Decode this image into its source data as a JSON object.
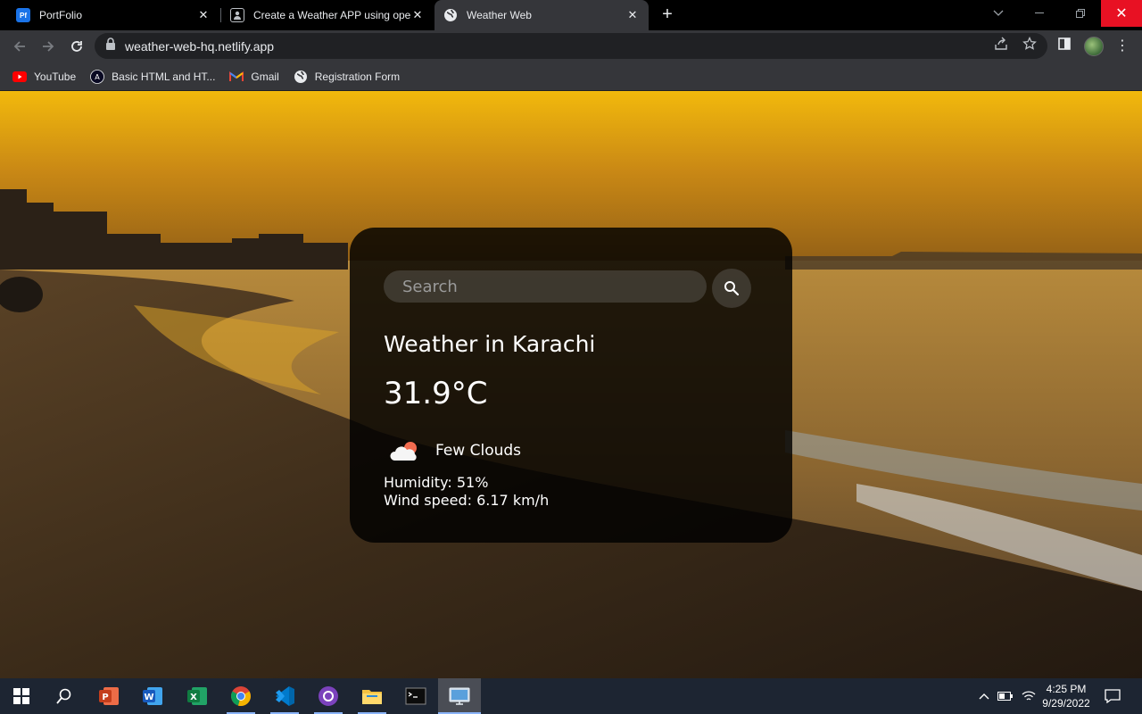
{
  "browser": {
    "tabs": [
      {
        "title": "PortFolio",
        "favicon": "Pf"
      },
      {
        "title": "Create a Weather APP using ope",
        "favicon": "person-icon"
      },
      {
        "title": "Weather Web",
        "favicon": "globe-icon"
      }
    ],
    "url": "weather-web-hq.netlify.app",
    "bookmarks": [
      {
        "label": "YouTube"
      },
      {
        "label": "Basic HTML and HT..."
      },
      {
        "label": "Gmail"
      },
      {
        "label": "Registration Form"
      }
    ]
  },
  "weather": {
    "search_placeholder": "Search",
    "city": "Weather in Karachi",
    "temperature": "31.9°C",
    "description": "Few Clouds",
    "humidity": "Humidity: 51%",
    "wind": "Wind speed: 6.17 km/h"
  },
  "taskbar": {
    "time": "4:25 PM",
    "date": "9/29/2022"
  },
  "colors": {
    "accent": "#8ab4f8",
    "card_bg": "rgba(0,0,0,0.82)",
    "close_red": "#e81123"
  }
}
